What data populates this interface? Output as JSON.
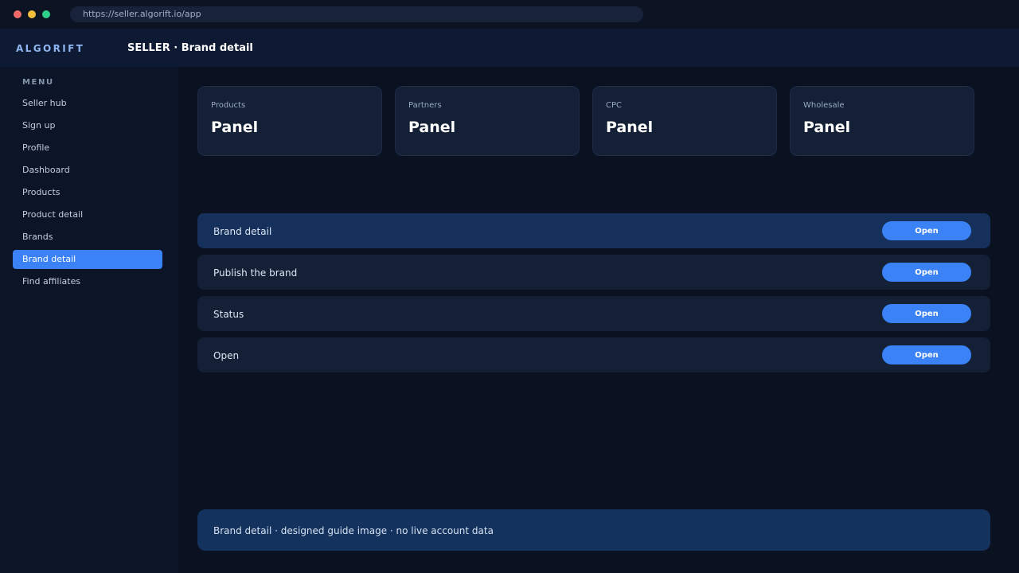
{
  "browser": {
    "url": "https://seller.algorift.io/app"
  },
  "header": {
    "logo": "ALGORIFT",
    "title": "SELLER · Brand detail"
  },
  "sidebar": {
    "heading": "MENU",
    "items": [
      {
        "label": "Seller hub"
      },
      {
        "label": "Sign up"
      },
      {
        "label": "Profile"
      },
      {
        "label": "Dashboard"
      },
      {
        "label": "Products"
      },
      {
        "label": "Product detail"
      },
      {
        "label": "Brands"
      },
      {
        "label": "Brand detail",
        "active": true
      },
      {
        "label": "Find affiliates"
      }
    ]
  },
  "cards": [
    {
      "label": "Products",
      "value": "Panel"
    },
    {
      "label": "Partners",
      "value": "Panel"
    },
    {
      "label": "CPC",
      "value": "Panel"
    },
    {
      "label": "Wholesale",
      "value": "Panel"
    }
  ],
  "rows": [
    {
      "label": "Brand detail",
      "button": "Open",
      "highlighted": true
    },
    {
      "label": "Publish the brand",
      "button": "Open"
    },
    {
      "label": "Status",
      "button": "Open"
    },
    {
      "label": "Open",
      "button": "Open"
    }
  ],
  "footer": {
    "text": "Brand detail · designed guide image · no live account data"
  },
  "colors": {
    "accent": "#3b82f6",
    "background": "#0a1120",
    "highlight_row": "#15305b"
  }
}
